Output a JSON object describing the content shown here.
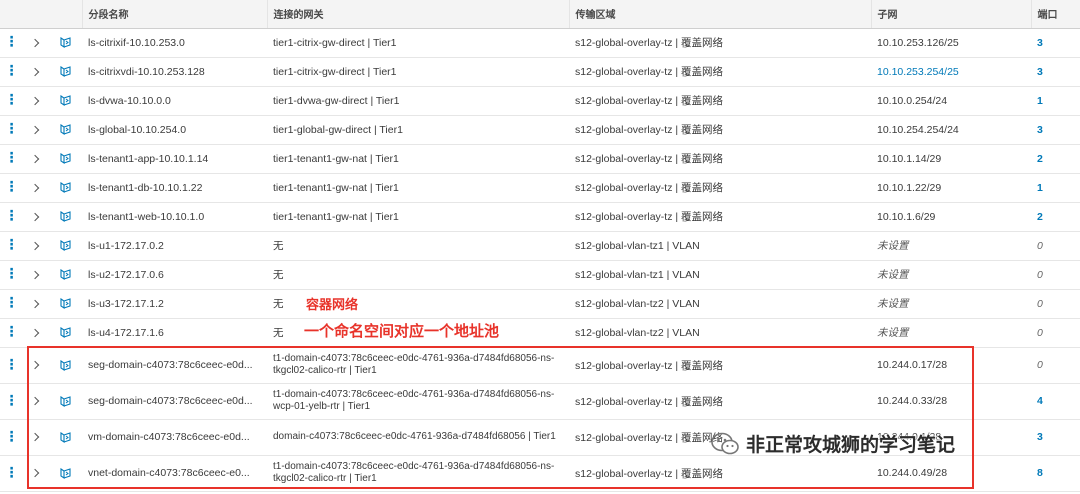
{
  "columns": {
    "name": "分段名称",
    "gateway": "连接的网关",
    "zone": "传输区域",
    "subnet": "子网",
    "ports": "端口"
  },
  "rows": [
    {
      "name": "ls-citrixif-10.10.253.0",
      "gateway": "tier1-citrix-gw-direct | Tier1",
      "zone": "s12-global-overlay-tz | 覆盖网络",
      "subnet": "10.10.253.126/25",
      "subnet_link": false,
      "ports": "3",
      "ports_link": true
    },
    {
      "name": "ls-citrixvdi-10.10.253.128",
      "gateway": "tier1-citrix-gw-direct | Tier1",
      "zone": "s12-global-overlay-tz | 覆盖网络",
      "subnet": "10.10.253.254/25",
      "subnet_link": true,
      "ports": "3",
      "ports_link": true
    },
    {
      "name": "ls-dvwa-10.10.0.0",
      "gateway": "tier1-dvwa-gw-direct | Tier1",
      "zone": "s12-global-overlay-tz | 覆盖网络",
      "subnet": "10.10.0.254/24",
      "subnet_link": false,
      "ports": "1",
      "ports_link": true
    },
    {
      "name": "ls-global-10.10.254.0",
      "gateway": "tier1-global-gw-direct | Tier1",
      "zone": "s12-global-overlay-tz | 覆盖网络",
      "subnet": "10.10.254.254/24",
      "subnet_link": false,
      "ports": "3",
      "ports_link": true
    },
    {
      "name": "ls-tenant1-app-10.10.1.14",
      "gateway": "tier1-tenant1-gw-nat | Tier1",
      "zone": "s12-global-overlay-tz | 覆盖网络",
      "subnet": "10.10.1.14/29",
      "subnet_link": false,
      "ports": "2",
      "ports_link": true
    },
    {
      "name": "ls-tenant1-db-10.10.1.22",
      "gateway": "tier1-tenant1-gw-nat | Tier1",
      "zone": "s12-global-overlay-tz | 覆盖网络",
      "subnet": "10.10.1.22/29",
      "subnet_link": false,
      "ports": "1",
      "ports_link": true
    },
    {
      "name": "ls-tenant1-web-10.10.1.0",
      "gateway": "tier1-tenant1-gw-nat | Tier1",
      "zone": "s12-global-overlay-tz | 覆盖网络",
      "subnet": "10.10.1.6/29",
      "subnet_link": false,
      "ports": "2",
      "ports_link": true
    },
    {
      "name": "ls-u1-172.17.0.2",
      "gateway": "无",
      "zone": "s12-global-vlan-tz1 | VLAN",
      "subnet": "未设置",
      "subnet_unset": true,
      "ports": "0",
      "ports_link": false
    },
    {
      "name": "ls-u2-172.17.0.6",
      "gateway": "无",
      "zone": "s12-global-vlan-tz1 | VLAN",
      "subnet": "未设置",
      "subnet_unset": true,
      "ports": "0",
      "ports_link": false
    },
    {
      "name": "ls-u3-172.17.1.2",
      "gateway": "无",
      "zone": "s12-global-vlan-tz2 | VLAN",
      "subnet": "未设置",
      "subnet_unset": true,
      "ports": "0",
      "ports_link": false
    },
    {
      "name": "ls-u4-172.17.1.6",
      "gateway": "无",
      "zone": "s12-global-vlan-tz2 | VLAN",
      "subnet": "未设置",
      "subnet_unset": true,
      "ports": "0",
      "ports_link": false
    },
    {
      "name": "seg-domain-c4073:78c6ceec-e0d...",
      "gateway": "t1-domain-c4073:78c6ceec-e0dc-4761-936a-d7484fd68056-ns-tkgcl02-calico-rtr | Tier1",
      "zone": "s12-global-overlay-tz | 覆盖网络",
      "subnet": "10.244.0.17/28",
      "subnet_link": false,
      "ports": "0",
      "ports_link": false,
      "tall": true
    },
    {
      "name": "seg-domain-c4073:78c6ceec-e0d...",
      "gateway": "t1-domain-c4073:78c6ceec-e0dc-4761-936a-d7484fd68056-ns-wcp-01-yelb-rtr | Tier1",
      "zone": "s12-global-overlay-tz | 覆盖网络",
      "subnet": "10.244.0.33/28",
      "subnet_link": false,
      "ports": "4",
      "ports_link": true,
      "tall": true
    },
    {
      "name": "vm-domain-c4073:78c6ceec-e0d...",
      "gateway": "domain-c4073:78c6ceec-e0dc-4761-936a-d7484fd68056 | Tier1",
      "zone": "s12-global-overlay-tz | 覆盖网络",
      "subnet": "10.244.0.1/28",
      "subnet_link": false,
      "ports": "3",
      "ports_link": true,
      "tall": true
    },
    {
      "name": "vnet-domain-c4073:78c6ceec-e0...",
      "gateway": "t1-domain-c4073:78c6ceec-e0dc-4761-936a-d7484fd68056-ns-tkgcl02-calico-rtr | Tier1",
      "zone": "s12-global-overlay-tz | 覆盖网络",
      "subnet": "10.244.0.49/28",
      "subnet_link": false,
      "ports": "8",
      "ports_link": true,
      "tall": true
    }
  ],
  "annotations": {
    "line1": "容器网络",
    "line2": "一个命名空间对应一个地址池",
    "color": "#e8332a"
  },
  "watermark": {
    "text": "非正常攻城狮的学习笔记",
    "icon": "wechat-icon"
  },
  "colors": {
    "link": "#0079b8",
    "header_bg": "#f4f4f4"
  }
}
